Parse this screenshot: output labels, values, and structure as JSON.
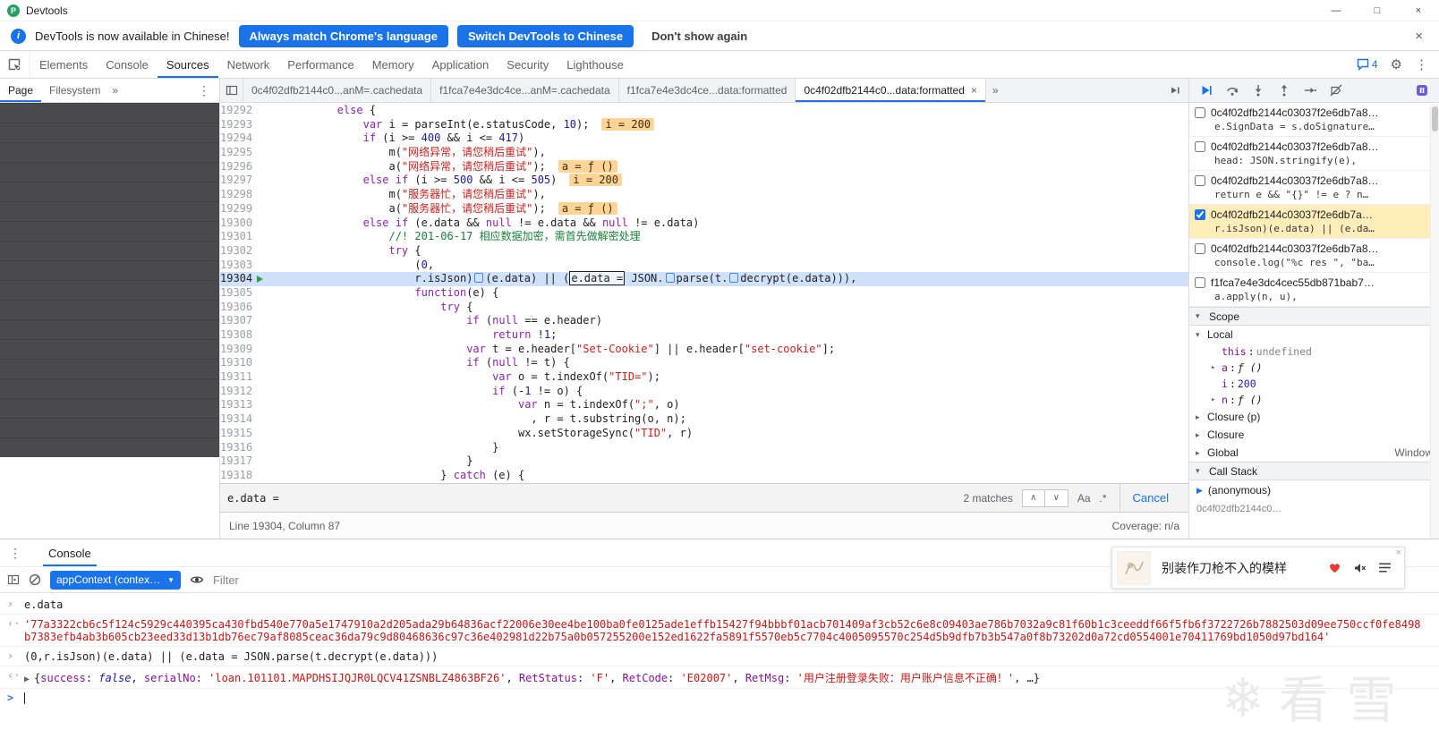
{
  "icons": {
    "minimize": "—",
    "maximize": "□",
    "close": "×",
    "kebab": "⋮",
    "overflow": "»",
    "gear": "⚙",
    "prev": "∧",
    "next": "∨",
    "snowflake": "❄"
  },
  "window": {
    "title": "Devtools",
    "app_badge": "P"
  },
  "infobar": {
    "message": "DevTools is now available in Chinese!",
    "primary_buttons": [
      "Always match Chrome's language",
      "Switch DevTools to Chinese"
    ],
    "secondary_button": "Don't show again"
  },
  "main_toolbar": {
    "tabs": [
      "Elements",
      "Console",
      "Sources",
      "Network",
      "Performance",
      "Memory",
      "Application",
      "Security",
      "Lighthouse"
    ],
    "selected_tab": "Sources",
    "message_count": "4"
  },
  "navigator": {
    "tabs": [
      "Page",
      "Filesystem"
    ],
    "selected": "Page"
  },
  "editor": {
    "tabs": [
      {
        "label": "0c4f02dfb2144c0...anM=.cachedata",
        "active": false
      },
      {
        "label": "f1fca7e4e3dc4ce...anM=.cachedata",
        "active": false
      },
      {
        "label": "f1fca7e4e3dc4ce...data:formatted",
        "active": false
      },
      {
        "label": "0c4f02dfb2144c0...data:formatted",
        "active": true
      }
    ],
    "code_lines": [
      {
        "no": "19292",
        "ind": 12,
        "tok": [
          [
            "k",
            "else"
          ],
          [
            "t",
            " {"
          ]
        ]
      },
      {
        "no": "19293",
        "ind": 16,
        "tok": [
          [
            "k",
            "var"
          ],
          [
            "t",
            " i = parseInt(e.statusCode, "
          ],
          [
            "n",
            "10"
          ],
          [
            "t",
            ");"
          ]
        ],
        "hint": "i = 200"
      },
      {
        "no": "19294",
        "ind": 16,
        "tok": [
          [
            "k",
            "if"
          ],
          [
            "t",
            " (i >= "
          ],
          [
            "n",
            "400"
          ],
          [
            "t",
            " && i <= "
          ],
          [
            "n",
            "417"
          ],
          [
            "t",
            ")"
          ]
        ]
      },
      {
        "no": "19295",
        "ind": 20,
        "tok": [
          [
            "t",
            "m("
          ],
          [
            "s",
            "\"网络异常，请您稍后重试\""
          ],
          [
            "t",
            "),"
          ]
        ]
      },
      {
        "no": "19296",
        "ind": 20,
        "tok": [
          [
            "t",
            "a("
          ],
          [
            "s",
            "\"网络异常，请您稍后重试\""
          ],
          [
            "t",
            ");"
          ]
        ],
        "hint": "a = ƒ ()"
      },
      {
        "no": "19297",
        "ind": 16,
        "tok": [
          [
            "k",
            "else"
          ],
          [
            "t",
            " "
          ],
          [
            "k",
            "if"
          ],
          [
            "t",
            " (i >= "
          ],
          [
            "n",
            "500"
          ],
          [
            "t",
            " && i <= "
          ],
          [
            "n",
            "505"
          ],
          [
            "t",
            ")"
          ]
        ],
        "hint": "i = 200"
      },
      {
        "no": "19298",
        "ind": 20,
        "tok": [
          [
            "t",
            "m("
          ],
          [
            "s",
            "\"服务器忙，请您稍后重试\""
          ],
          [
            "t",
            "),"
          ]
        ]
      },
      {
        "no": "19299",
        "ind": 20,
        "tok": [
          [
            "t",
            "a("
          ],
          [
            "s",
            "\"服务器忙，请您稍后重试\""
          ],
          [
            "t",
            ");"
          ]
        ],
        "hint": "a = ƒ ()"
      },
      {
        "no": "19300",
        "ind": 16,
        "tok": [
          [
            "k",
            "else"
          ],
          [
            "t",
            " "
          ],
          [
            "k",
            "if"
          ],
          [
            "t",
            " (e.data && "
          ],
          [
            "k",
            "null"
          ],
          [
            "t",
            " != e.data && "
          ],
          [
            "k",
            "null"
          ],
          [
            "t",
            " != e.data)"
          ]
        ]
      },
      {
        "no": "19301",
        "ind": 20,
        "tok": [
          [
            "c",
            "//! 201-06-17 相应数据加密，需首先做解密处理"
          ]
        ]
      },
      {
        "no": "19302",
        "ind": 20,
        "tok": [
          [
            "k",
            "try"
          ],
          [
            "t",
            " {"
          ]
        ]
      },
      {
        "no": "19303",
        "ind": 24,
        "tok": [
          [
            "t",
            "("
          ],
          [
            "n",
            "0"
          ],
          [
            "t",
            ","
          ]
        ]
      },
      {
        "no": "19304",
        "ind": 24,
        "exec": true,
        "tok": [
          [
            "t",
            "r.isJson)"
          ],
          [
            "mk",
            ""
          ],
          [
            "t",
            "(e.data) || ("
          ],
          [
            "match",
            "e.data ="
          ],
          [
            "t",
            " JSON."
          ],
          [
            "mk",
            ""
          ],
          [
            "t",
            "parse(t."
          ],
          [
            "mk",
            ""
          ],
          [
            "t",
            "decrypt(e.data))),"
          ]
        ]
      },
      {
        "no": "19305",
        "ind": 24,
        "tok": [
          [
            "k",
            "function"
          ],
          [
            "t",
            "(e) {"
          ]
        ]
      },
      {
        "no": "19306",
        "ind": 28,
        "tok": [
          [
            "k",
            "try"
          ],
          [
            "t",
            " {"
          ]
        ]
      },
      {
        "no": "19307",
        "ind": 32,
        "tok": [
          [
            "k",
            "if"
          ],
          [
            "t",
            " ("
          ],
          [
            "k",
            "null"
          ],
          [
            "t",
            " == e.header)"
          ]
        ]
      },
      {
        "no": "19308",
        "ind": 36,
        "tok": [
          [
            "k",
            "return"
          ],
          [
            "t",
            " !"
          ],
          [
            "n",
            "1"
          ],
          [
            "t",
            ";"
          ]
        ]
      },
      {
        "no": "19309",
        "ind": 32,
        "tok": [
          [
            "k",
            "var"
          ],
          [
            "t",
            " t = e.header["
          ],
          [
            "s",
            "\"Set-Cookie\""
          ],
          [
            "t",
            "] || e.header["
          ],
          [
            "s",
            "\"set-cookie\""
          ],
          [
            "t",
            "];"
          ]
        ]
      },
      {
        "no": "19310",
        "ind": 32,
        "tok": [
          [
            "k",
            "if"
          ],
          [
            "t",
            " ("
          ],
          [
            "k",
            "null"
          ],
          [
            "t",
            " != t) {"
          ]
        ]
      },
      {
        "no": "19311",
        "ind": 36,
        "tok": [
          [
            "k",
            "var"
          ],
          [
            "t",
            " o = t.indexOf("
          ],
          [
            "s",
            "\"TID=\""
          ],
          [
            "t",
            ");"
          ]
        ]
      },
      {
        "no": "19312",
        "ind": 36,
        "tok": [
          [
            "k",
            "if"
          ],
          [
            "t",
            " (-"
          ],
          [
            "n",
            "1"
          ],
          [
            "t",
            " != o) {"
          ]
        ]
      },
      {
        "no": "19313",
        "ind": 40,
        "tok": [
          [
            "k",
            "var"
          ],
          [
            "t",
            " n = t.indexOf("
          ],
          [
            "s",
            "\";\""
          ],
          [
            "t",
            ", o)"
          ]
        ]
      },
      {
        "no": "19314",
        "ind": 42,
        "tok": [
          [
            "t",
            ", r = t.substring(o, n);"
          ]
        ]
      },
      {
        "no": "19315",
        "ind": 40,
        "tok": [
          [
            "t",
            "wx.setStorageSync("
          ],
          [
            "s",
            "\"TID\""
          ],
          [
            "t",
            ", r)"
          ]
        ]
      },
      {
        "no": "19316",
        "ind": 36,
        "tok": [
          [
            "t",
            "}"
          ]
        ]
      },
      {
        "no": "19317",
        "ind": 32,
        "tok": [
          [
            "t",
            "}"
          ]
        ]
      },
      {
        "no": "19318",
        "ind": 28,
        "tok": [
          [
            "t",
            "} "
          ],
          [
            "k",
            "catch"
          ],
          [
            "t",
            " (e) {"
          ]
        ]
      }
    ],
    "search": {
      "query": "e.data =",
      "matches": "2 matches",
      "case": "Aa",
      "regex": ".*",
      "cancel": "Cancel"
    },
    "status": {
      "position": "Line 19304, Column 87",
      "coverage": "Coverage: n/a"
    }
  },
  "debugger": {
    "breakpoints": [
      {
        "checked": false,
        "active": false,
        "file": "0c4f02dfb2144c03037f2e6db7a8…",
        "code": "e.SignData = s.doSignature…"
      },
      {
        "checked": false,
        "active": false,
        "file": "0c4f02dfb2144c03037f2e6db7a8…",
        "code": "head: JSON.stringify(e),"
      },
      {
        "checked": false,
        "active": false,
        "file": "0c4f02dfb2144c03037f2e6db7a8…",
        "code": "return e && \"{}\" != e ? n…"
      },
      {
        "checked": true,
        "active": true,
        "file": "0c4f02dfb2144c03037f2e6db7a…",
        "code": "r.isJson)(e.data) || (e.da…"
      },
      {
        "checked": false,
        "active": false,
        "file": "0c4f02dfb2144c03037f2e6db7a8…",
        "code": "console.log(\"%c res \", \"ba…"
      },
      {
        "checked": false,
        "active": false,
        "file": "f1fca7e4e3dc4cec55db871bab7…",
        "code": "a.apply(n, u),"
      }
    ],
    "scope_title": "Scope",
    "scope": [
      {
        "arrow": "▾",
        "label": "Local",
        "items": [
          {
            "arrow": "",
            "key": "this",
            "value": "undefined",
            "vclass": "v-undef"
          },
          {
            "arrow": "▸",
            "key": "a",
            "value": "ƒ ()",
            "vclass": "v-func"
          },
          {
            "arrow": "",
            "key": "i",
            "value": "200",
            "vclass": "v-num"
          },
          {
            "arrow": "▸",
            "key": "n",
            "value": "ƒ ()",
            "vclass": "v-func"
          }
        ]
      },
      {
        "arrow": "▸",
        "label": "Closure (p)",
        "items": []
      },
      {
        "arrow": "▸",
        "label": "Closure",
        "items": []
      },
      {
        "arrow": "▸",
        "label": "Global",
        "right": "Window",
        "items": []
      }
    ],
    "callstack_title": "Call Stack",
    "frames": [
      {
        "name": "(anonymous)",
        "active": true,
        "partial": false
      },
      {
        "name": "0c4f02dfb2144c0…",
        "active": false,
        "partial": true
      }
    ]
  },
  "console_panel": {
    "tab_label": "Console",
    "context_selector": "appContext (contex…",
    "filter_placeholder": "Filter",
    "widget": {
      "title": "别装作刀枪不入的模样"
    },
    "watermark": "看雪",
    "entries": [
      {
        "type": "input",
        "text": "e.data"
      },
      {
        "type": "string",
        "text": "'77a3322cb6c5f124c5929c440395ca430fbd540e770a5e1747910a2d205ada29b64836acf22006e30ee4be100ba0fe0125ade1effb15427f94bbbf01acb701409af3cb52c6e8c09403ae786b7032a9c81f60b1c3ceeddf66f5fb6f3722726b7882503d09ee750ccf0fe8498b7383efb4ab3b605cb23eed33d13b1db76ec79af8085ceac36da79c9d80468636c97c36e402981d22b75a0b057255200e152ed1622fa5891f5570eb5c7704c4005095570c254d5b9dfb7b3b547a0f8b73202d0a72cd0554001e70411769bd1050d97bd164'"
      },
      {
        "type": "input",
        "text": "(0,r.isJson)(e.data) || (e.data = JSON.parse(t.decrypt(e.data)))"
      },
      {
        "type": "object",
        "tok": [
          [
            "t",
            "{"
          ],
          [
            "key",
            "success"
          ],
          [
            "t",
            ": "
          ],
          [
            "bool",
            "false"
          ],
          [
            "t",
            ", "
          ],
          [
            "key",
            "serialNo"
          ],
          [
            "t",
            ": "
          ],
          [
            "str",
            "'loan.101101.MAPDHSIJQJR0LQCV41ZSNBLZ4863BF26'"
          ],
          [
            "t",
            ", "
          ],
          [
            "key",
            "RetStatus"
          ],
          [
            "t",
            ": "
          ],
          [
            "str",
            "'F'"
          ],
          [
            "t",
            ", "
          ],
          [
            "key",
            "RetCode"
          ],
          [
            "t",
            ": "
          ],
          [
            "str",
            "'E02007'"
          ],
          [
            "t",
            ", "
          ],
          [
            "key",
            "RetMsg"
          ],
          [
            "t",
            ": "
          ],
          [
            "str",
            "'用户注册登录失败：用户账户信息不正确！'"
          ],
          [
            "t",
            ", …}"
          ]
        ]
      },
      {
        "type": "prompt"
      }
    ]
  }
}
